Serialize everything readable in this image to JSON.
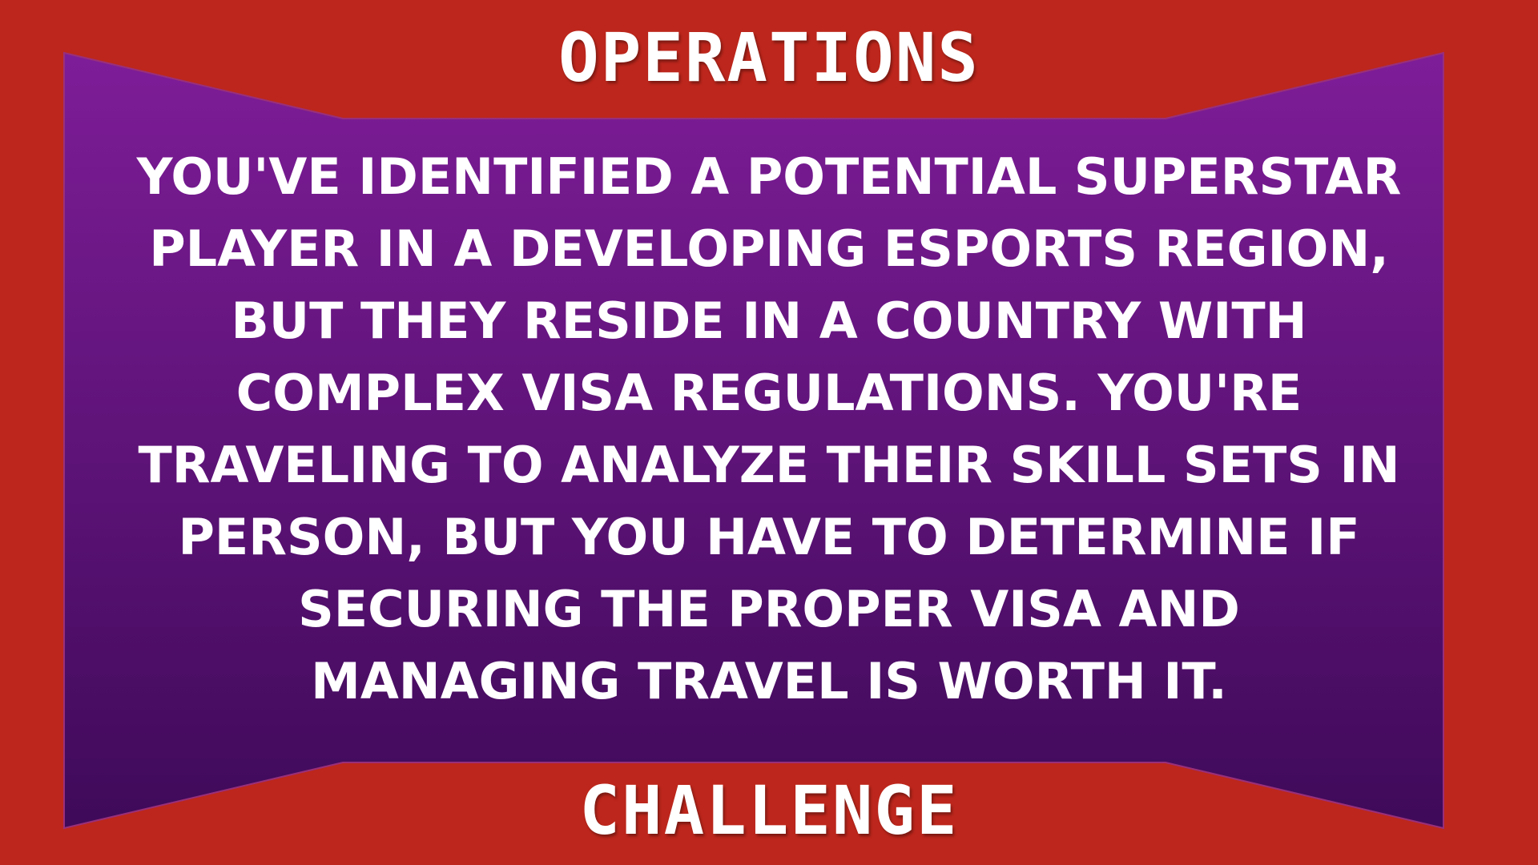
{
  "header": {
    "title": "OPERATIONS"
  },
  "card": {
    "body": "YOU'VE IDENTIFIED A POTENTIAL SUPERSTAR PLAYER IN A DEVELOPING ESPORTS REGION, BUT THEY RESIDE IN A COUNTRY WITH COMPLEX VISA REGULATIONS. YOU'RE TRAVELING TO ANALYZE THEIR SKILL SETS IN PERSON, BUT YOU HAVE TO DETERMINE IF SECURING THE PROPER VISA AND MANAGING TRAVEL IS WORTH IT."
  },
  "footer": {
    "title": "CHALLENGE"
  },
  "colors": {
    "border_red": "#bd261c",
    "panel_purple_top": "#7e1d98",
    "panel_purple_bottom": "#3f0a59",
    "text": "#ffffff"
  }
}
